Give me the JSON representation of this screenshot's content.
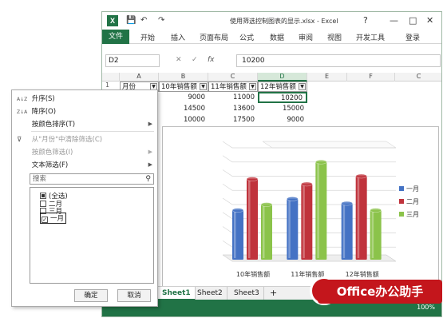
{
  "window": {
    "title": "使用筛选控制图表的显示.xlsx - Excel",
    "help": "?",
    "minimize": "—",
    "maximize": "□",
    "close": "✕",
    "login": "登录"
  },
  "quick_access": {
    "save": "💾",
    "undo": "↶",
    "redo": "↷"
  },
  "ribbon_tabs": [
    "文件",
    "开始",
    "插入",
    "页面布局",
    "公式",
    "数据",
    "审阅",
    "视图",
    "开发工具"
  ],
  "formula_bar": {
    "name_box": "D2",
    "cancel": "✕",
    "enter": "✓",
    "fx": "fx",
    "value": "10200"
  },
  "columns": [
    "A",
    "B",
    "C",
    "D",
    "E",
    "F",
    "C"
  ],
  "rows": {
    "header": {
      "row": "1",
      "a": "月份",
      "b": "10年销售额",
      "c": "11年销售额",
      "d": "12年销售额"
    },
    "data": [
      {
        "b": "9000",
        "c": "11000",
        "d": "10200"
      },
      {
        "b": "14500",
        "c": "13600",
        "d": "15000"
      },
      {
        "b": "10000",
        "c": "17500",
        "d": "9000"
      }
    ]
  },
  "chart_data": {
    "type": "bar",
    "categories": [
      "10年销售额",
      "11年销售额",
      "12年销售额"
    ],
    "series": [
      {
        "name": "一月",
        "values": [
          9000,
          11000,
          10200
        ],
        "color": "#4472c4"
      },
      {
        "name": "二月",
        "values": [
          14500,
          13600,
          15000
        ],
        "color": "#c0333c"
      },
      {
        "name": "三月",
        "values": [
          10000,
          17500,
          9000
        ],
        "color": "#8bc34a"
      }
    ],
    "ylim": [
      0,
      20000
    ],
    "grid": true,
    "legend_position": "right"
  },
  "sheets": [
    "Sheet1",
    "Sheet2",
    "Sheet3"
  ],
  "sheet_add": "+",
  "zoom": "100%",
  "brand": "Office办公助手",
  "filter_menu": {
    "items": [
      {
        "icon": "A↓Z",
        "label": "升序(S)"
      },
      {
        "icon": "Z↓A",
        "label": "降序(O)"
      },
      {
        "icon": "",
        "label": "按颜色排序(T)"
      },
      {
        "icon": "⊽",
        "label": "从\"月份\"中清除筛选(C)"
      },
      {
        "icon": "",
        "label": "按颜色筛选(I)"
      },
      {
        "icon": "",
        "label": "文本筛选(F)"
      }
    ],
    "submenu_arrow": "▶",
    "search_placeholder": "搜索",
    "search_icon": "⚲",
    "list": [
      {
        "label": "(全选)",
        "state": "mixed"
      },
      {
        "label": "二月",
        "state": "unchecked"
      },
      {
        "label": "三月",
        "state": "unchecked"
      },
      {
        "label": "一月",
        "state": "checked"
      }
    ],
    "ok": "确定",
    "cancel": "取消"
  }
}
